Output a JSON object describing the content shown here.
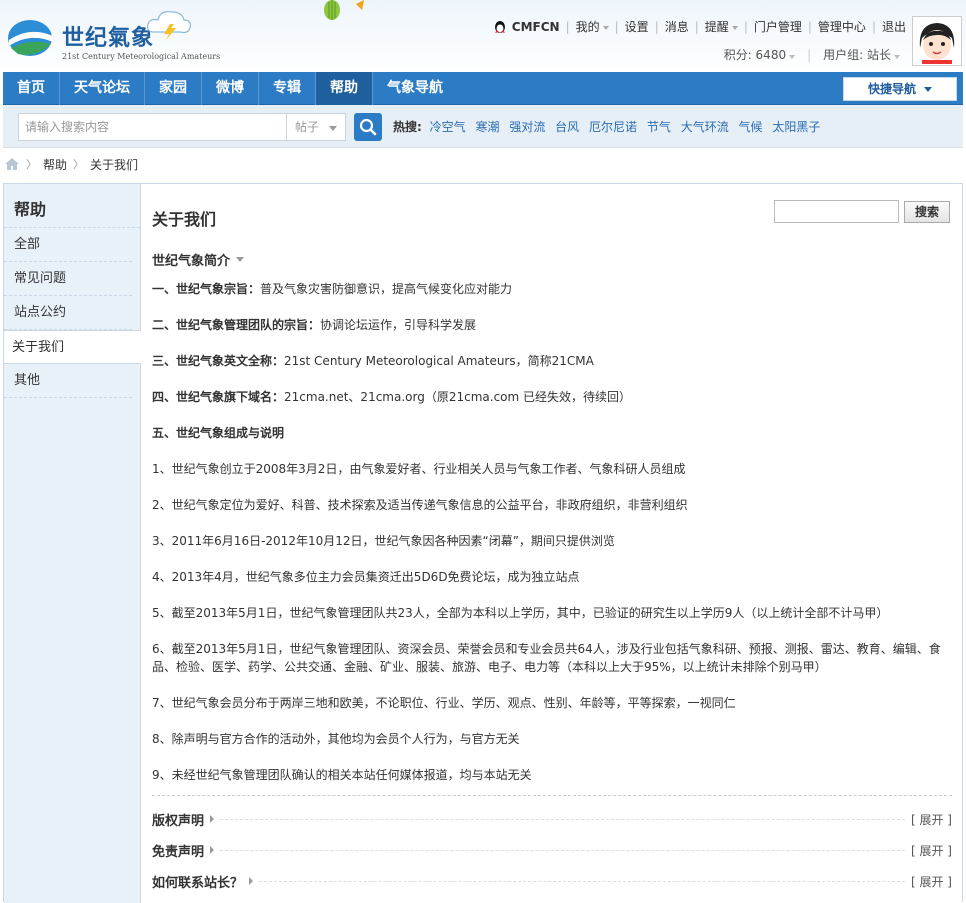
{
  "header": {
    "brand_cn": "世纪氣象",
    "brand_en": "21st Century Meteorological Amateurs",
    "user": {
      "username": "CMFCN",
      "links": [
        "我的",
        "设置",
        "消息",
        "提醒",
        "门户管理",
        "管理中心",
        "退出"
      ],
      "points_label": "积分: 6480",
      "group_label": "用户组: 站长"
    }
  },
  "nav": {
    "items": [
      "首页",
      "天气论坛",
      "家园",
      "微博",
      "专辑",
      "帮助",
      "气象导航"
    ],
    "active_index": 5,
    "quick_nav": "快捷导航"
  },
  "search": {
    "placeholder": "请输入搜索内容",
    "type": "帖子",
    "hot_label": "热搜:",
    "hot_keywords": [
      "冷空气",
      "寒潮",
      "强对流",
      "台风",
      "厄尔尼诺",
      "节气",
      "大气环流",
      "气候",
      "太阳黑子"
    ]
  },
  "breadcrumb": [
    "帮助",
    "关于我们"
  ],
  "sidebar": {
    "title": "帮助",
    "items": [
      "全部",
      "常见问题",
      "站点公约",
      "关于我们",
      "其他"
    ],
    "active_index": 3
  },
  "content": {
    "title": "关于我们",
    "search_button": "搜索",
    "intro_heading": "世纪气象简介",
    "sections": [
      {
        "label": "一、世纪气象宗旨：",
        "text": "普及气象灾害防御意识，提高气候变化应对能力"
      },
      {
        "label": "二、世纪气象管理团队的宗旨：",
        "text": "协调论坛运作，引导科学发展"
      },
      {
        "label": "三、世纪气象英文全称：",
        "text": "21st Century Meteorological Amateurs，简称21CMA"
      },
      {
        "label": "四、世纪气象旗下域名：",
        "text": "21cma.net、21cma.org（原21cma.com 已经失效，待续回）"
      },
      {
        "label": "五、世纪气象组成与说明",
        "text": ""
      }
    ],
    "items": [
      "1、世纪气象创立于2008年3月2日，由气象爱好者、行业相关人员与气象工作者、气象科研人员组成",
      "2、世纪气象定位为爱好、科普、技术探索及适当传递气象信息的公益平台，非政府组织，非营利组织",
      "3、2011年6月16日-2012年10月12日，世纪气象因各种因素“闭幕”，期间只提供浏览",
      "4、2013年4月，世纪气象多位主力会员集资迁出5D6D免费论坛，成为独立站点",
      "5、截至2013年5月1日，世纪气象管理团队共23人，全部为本科以上学历，其中，已验证的研究生以上学历9人（以上统计全部不计马甲）",
      "6、截至2013年5月1日，世纪气象管理团队、资深会员、荣誉会员和专业会员共64人，涉及行业包括气象科研、预报、测报、雷达、教育、编辑、食品、检验、医学、药学、公共交通、金融、矿业、服装、旅游、电子、电力等（本科以上大于95%，以上统计未排除个别马甲）",
      "7、世纪气象会员分布于两岸三地和欧美，不论职位、行业、学历、观点、性别、年龄等，平等探索，一视同仁",
      "8、除声明与官方合作的活动外，其他均为会员个人行为，与官方无关",
      "9、未经世纪气象管理团队确认的相关本站任何媒体报道，均与本站无关"
    ],
    "folds": [
      {
        "title": "版权声明",
        "action": "[ 展开 ]"
      },
      {
        "title": "免责声明",
        "action": "[ 展开 ]"
      },
      {
        "title": "如何联系站长？",
        "action": "[ 展开 ]"
      }
    ]
  }
}
